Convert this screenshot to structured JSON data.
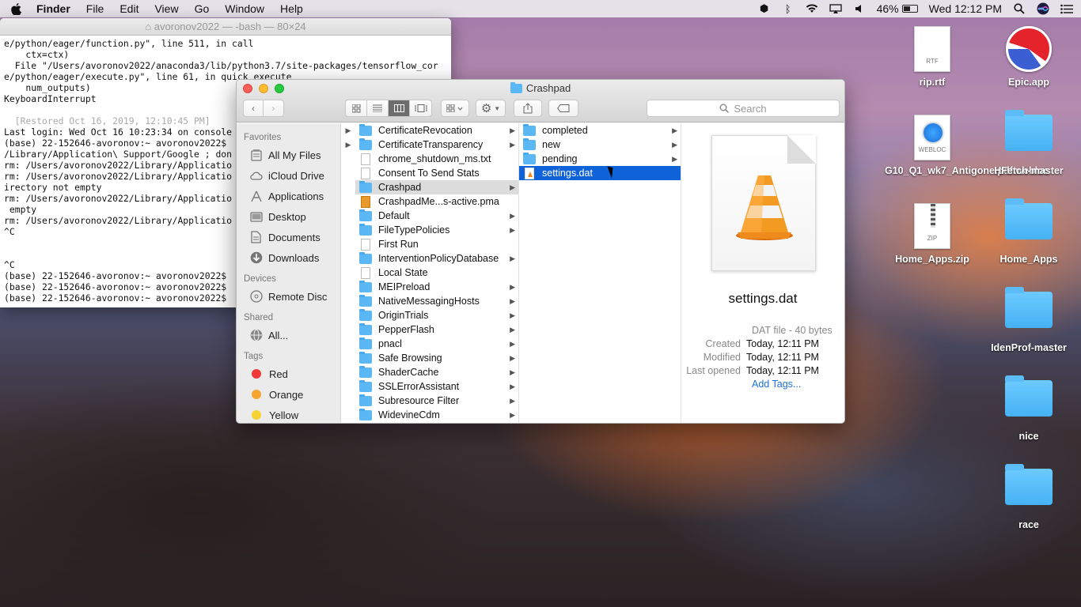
{
  "menubar": {
    "app": "Finder",
    "items": [
      "File",
      "Edit",
      "View",
      "Go",
      "Window",
      "Help"
    ],
    "battery_percent": "46%",
    "clock": "Wed 12:12 PM",
    "battery_level": 0.46
  },
  "terminal": {
    "title": "avoronov2022 — -bash — 80×24",
    "lines": [
      "e/python/eager/function.py\", line 511, in call",
      "    ctx=ctx)",
      "  File \"/Users/avoronov2022/anaconda3/lib/python3.7/site-packages/tensorflow_cor",
      "e/python/eager/execute.py\", line 61, in quick_execute",
      "    num_outputs)",
      "KeyboardInterrupt",
      "",
      "  [Restored Oct 16, 2019, 12:10:45 PM]",
      "Last login: Wed Oct 16 10:23:34 on console",
      "(base) 22-152646-avoronov:~ avoronov2022$",
      "/Library/Application\\ Support/Google ; don",
      "rm: /Users/avoronov2022/Library/Applicatio",
      "rm: /Users/avoronov2022/Library/Applicatio",
      "irectory not empty",
      "rm: /Users/avoronov2022/Library/Applicatio",
      " empty",
      "rm: /Users/avoronov2022/Library/Applicatio",
      "^C",
      "",
      "",
      "^C",
      "(base) 22-152646-avoronov:~ avoronov2022$",
      "(base) 22-152646-avoronov:~ avoronov2022$",
      "(base) 22-152646-avoronov:~ avoronov2022$"
    ]
  },
  "finder": {
    "title": "Crashpad",
    "search_placeholder": "Search",
    "sidebar": {
      "favorites_label": "Favorites",
      "favorites": [
        "All My Files",
        "iCloud Drive",
        "Applications",
        "Desktop",
        "Documents",
        "Downloads"
      ],
      "devices_label": "Devices",
      "devices": [
        "Remote Disc"
      ],
      "shared_label": "Shared",
      "shared": [
        "All..."
      ],
      "tags_label": "Tags",
      "tags": [
        {
          "name": "Red",
          "color": "#f0383a"
        },
        {
          "name": "Orange",
          "color": "#f7a530"
        },
        {
          "name": "Yellow",
          "color": "#f6d330"
        }
      ]
    },
    "column1": [
      {
        "name": "CertificateRevocation",
        "type": "folder",
        "arrow": true
      },
      {
        "name": "CertificateTransparency",
        "type": "folder",
        "arrow": true
      },
      {
        "name": "chrome_shutdown_ms.txt",
        "type": "doc",
        "arrow": false
      },
      {
        "name": "Consent To Send Stats",
        "type": "doc",
        "arrow": false
      },
      {
        "name": "Crashpad",
        "type": "folder",
        "arrow": true,
        "selected": true
      },
      {
        "name": "CrashpadMe...s-active.pma",
        "type": "pma",
        "arrow": false
      },
      {
        "name": "Default",
        "type": "folder",
        "arrow": true
      },
      {
        "name": "FileTypePolicies",
        "type": "folder",
        "arrow": true
      },
      {
        "name": "First Run",
        "type": "doc",
        "arrow": false
      },
      {
        "name": "InterventionPolicyDatabase",
        "type": "folder",
        "arrow": true
      },
      {
        "name": "Local State",
        "type": "doc",
        "arrow": false
      },
      {
        "name": "MEIPreload",
        "type": "folder",
        "arrow": true
      },
      {
        "name": "NativeMessagingHosts",
        "type": "folder",
        "arrow": true
      },
      {
        "name": "OriginTrials",
        "type": "folder",
        "arrow": true
      },
      {
        "name": "PepperFlash",
        "type": "folder",
        "arrow": true
      },
      {
        "name": "pnacl",
        "type": "folder",
        "arrow": true
      },
      {
        "name": "Safe Browsing",
        "type": "folder",
        "arrow": true
      },
      {
        "name": "ShaderCache",
        "type": "folder",
        "arrow": true
      },
      {
        "name": "SSLErrorAssistant",
        "type": "folder",
        "arrow": true
      },
      {
        "name": "Subresource Filter",
        "type": "folder",
        "arrow": true
      },
      {
        "name": "WidevineCdm",
        "type": "folder",
        "arrow": true
      }
    ],
    "column2": [
      {
        "name": "completed",
        "type": "folder",
        "arrow": true
      },
      {
        "name": "new",
        "type": "folder",
        "arrow": true
      },
      {
        "name": "pending",
        "type": "folder",
        "arrow": true
      },
      {
        "name": "settings.dat",
        "type": "vlc",
        "arrow": false,
        "selected": true
      }
    ],
    "preview": {
      "name": "settings.dat",
      "kind": "DAT file - 40 bytes",
      "created_label": "Created",
      "created": "Today, 12:11 PM",
      "modified_label": "Modified",
      "modified": "Today, 12:11 PM",
      "opened_label": "Last opened",
      "opened": "Today, 12:11 PM",
      "add_tags": "Add Tags..."
    }
  },
  "desktop": {
    "icons": [
      {
        "label": "rip.rtf",
        "kind": "RTF"
      },
      {
        "label": "Epic.app",
        "kind": "app"
      },
      {
        "label": "G10_Q1_wk7_Antigone.pdf.webloc",
        "kind": "WEBLOC"
      },
      {
        "label": "HFetch-master",
        "kind": "folder"
      },
      {
        "label": "Home_Apps.zip",
        "kind": "ZIP"
      },
      {
        "label": "Home_Apps",
        "kind": "folder"
      },
      {
        "label": "IdenProf-master",
        "kind": "folder"
      },
      {
        "label": "nice",
        "kind": "folder"
      },
      {
        "label": "race",
        "kind": "folder"
      }
    ]
  }
}
